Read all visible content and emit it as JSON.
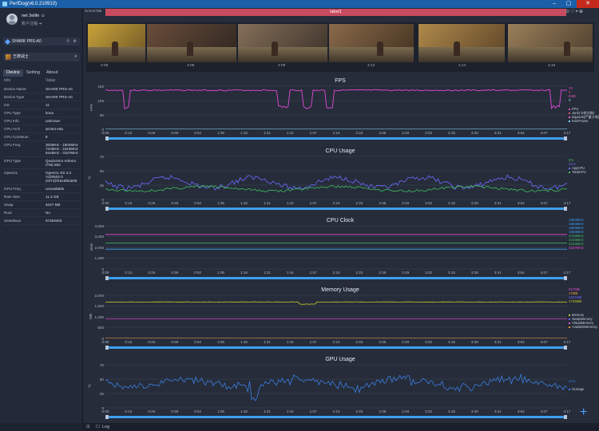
{
  "app": {
    "title": "PerfDog(v6.0.210910)"
  },
  "user": {
    "name": "net 3elife ☺",
    "logout": "账户注销 ➔"
  },
  "device": {
    "selected": "SHARK PRS-A0"
  },
  "app_select": {
    "selected": "王牌战士"
  },
  "tabs": [
    "Device",
    "Setting",
    "About"
  ],
  "info_header": {
    "key": "Info",
    "value": "Value"
  },
  "info_rows": [
    {
      "k": "Device Name",
      "v": "SHARK PRS-A0"
    },
    {
      "k": "Device Type",
      "v": "SHARK PRS-A0"
    },
    {
      "k": "OS",
      "v": "11"
    },
    {
      "k": "CPU Type",
      "v": "kona"
    },
    {
      "k": "CPU Info",
      "v": "unknown"
    },
    {
      "k": "CPU Arch",
      "v": "arm64-v8a"
    },
    {
      "k": "CPU CoreNum",
      "v": "8"
    },
    {
      "k": "CPU Freq",
      "v": "300MHz - 1804MHz\n710MHz - 2419MHz\n844MHz - 3187MHz"
    },
    {
      "k": "GPU Type",
      "v": "Qualcomm Adreno (TM) 650"
    },
    {
      "k": "OpenGL",
      "v": "OpenGL ES 3.2 V@0502.0 (GIT@f1916f0de05"
    },
    {
      "k": "GPU Freq",
      "v": "unavailable"
    },
    {
      "k": "Ram Size",
      "v": "11.3 GB"
    },
    {
      "k": "Swap",
      "v": "4047 MB"
    },
    {
      "k": "Root",
      "v": "No"
    },
    {
      "k": "SerialNum",
      "v": "974b9404"
    }
  ],
  "scene": {
    "tab_label": "SceneTab",
    "label": "label1"
  },
  "timeline": {
    "labels": [
      "4:06",
      "4:08",
      "4:09",
      "4:12",
      "4:14",
      "4:16"
    ]
  },
  "x_ticks": [
    "0:00",
    "0:13",
    "0:26",
    "0:39",
    "0:52",
    "1:05",
    "1:18",
    "1:31",
    "1:44",
    "1:57",
    "2:10",
    "2:23",
    "2:36",
    "2:49",
    "3:02",
    "3:15",
    "3:28",
    "3:41",
    "3:54",
    "4:07",
    "4:17"
  ],
  "colors": {
    "fps": "#e24ad4",
    "jank": "#ff66cc",
    "fps_low": "#7fe0ff",
    "app_cpu": "#6b6bff",
    "total_cpu": "#3fbf5f",
    "mem": "#c8c82a",
    "gpu": "#3b7fe0"
  },
  "panels": [
    {
      "title": "FPS",
      "ylabel": "FPS",
      "yticks": [
        "150",
        "100",
        "50",
        "0"
      ],
      "legend": [
        "FPS",
        "Jank(卡顿次数)",
        "BigJank(严重卡顿)",
        "InterFrame"
      ],
      "values": [
        "72",
        "0",
        "0.00",
        "0"
      ]
    },
    {
      "title": "CPU Usage",
      "ylabel": "%",
      "yticks": [
        "75",
        "50",
        "25",
        "0"
      ],
      "legend": [
        "AppCPU",
        "TotalCPU"
      ],
      "values": [
        "8%",
        "21%"
      ]
    },
    {
      "title": "CPU Clock",
      "ylabel": "MHz",
      "yticks": [
        "4,000",
        "3,000",
        "2,000",
        "1,000",
        "0"
      ],
      "legend": [],
      "values": [
        "1804MHz",
        "1804MHz",
        "1804MHz",
        "1804MHz",
        "2419MHz",
        "2419MHz",
        "2419MHz",
        "3187MHz"
      ]
    },
    {
      "title": "Memory Usage",
      "ylabel": "MB",
      "yticks": [
        "2,000",
        "1,500",
        "1,000",
        "500",
        "0"
      ],
      "legend": [
        "Memory",
        "SwapMemory",
        "VirtualMemory",
        "AvailableMemory"
      ],
      "values": [
        "817MB",
        "17MB",
        "2421MB",
        "1725MB"
      ]
    },
    {
      "title": "GPU Usage",
      "ylabel": "%",
      "yticks": [
        "75",
        "50",
        "25",
        "0"
      ],
      "legend": [
        "GUsage"
      ],
      "values": [
        "21%"
      ]
    }
  ],
  "bottom": {
    "log_label": "Log"
  }
}
